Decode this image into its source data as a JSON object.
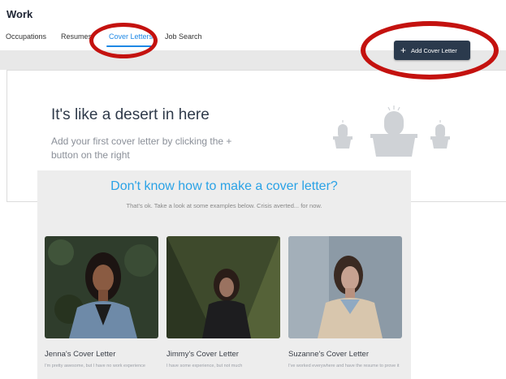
{
  "page": {
    "title": "Work"
  },
  "tabs": [
    {
      "label": "Occupations",
      "active": false
    },
    {
      "label": "Resumes",
      "active": false
    },
    {
      "label": "Cover Letters",
      "active": true
    },
    {
      "label": "Job Search",
      "active": false
    }
  ],
  "toolbar": {
    "add_label": "Add Cover Letter",
    "add_icon": "plus-icon"
  },
  "empty_state": {
    "title": "It's like a desert in here",
    "subtitle": "Add your first cover letter by clicking the + button on the right",
    "illustration": "cactus-pots-icon"
  },
  "help": {
    "title": "Don't know how to make a cover letter?",
    "subtitle": "That's ok. Take a look at some examples below. Crisis averted... for now.",
    "examples": [
      {
        "name": "Jenna's Cover Letter",
        "desc": "I'm pretty awesome, but I have no work experience"
      },
      {
        "name": "Jimmy's Cover Letter",
        "desc": "I have some experience, but not much"
      },
      {
        "name": "Suzanne's Cover Letter",
        "desc": "I've worked everywhere and have the resume to prove it"
      }
    ]
  },
  "colors": {
    "accent": "#1e88e5",
    "button": "#2b3a4d",
    "help_title": "#2aa2e6",
    "annotation": "#c4120f"
  }
}
